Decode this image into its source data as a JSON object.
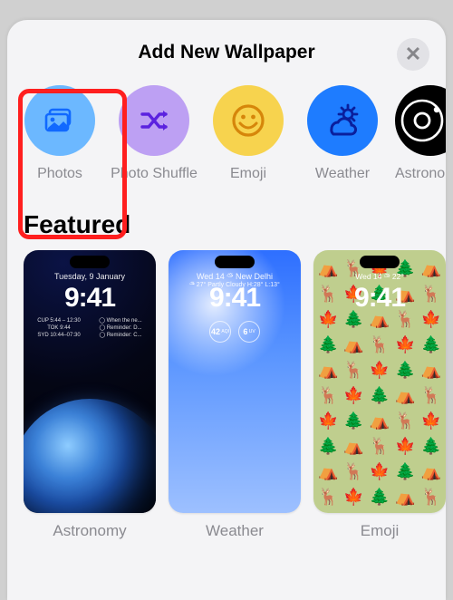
{
  "header": {
    "title": "Add New Wallpaper"
  },
  "categories": [
    {
      "key": "photos",
      "label": "Photos"
    },
    {
      "key": "shuffle",
      "label": "Photo Shuffle"
    },
    {
      "key": "emoji",
      "label": "Emoji"
    },
    {
      "key": "weather",
      "label": "Weather"
    },
    {
      "key": "astro",
      "label": "Astronomy"
    }
  ],
  "featured_heading": "Featured",
  "featured": [
    {
      "key": "astronomy",
      "label": "Astronomy",
      "date": "Tuesday, 9 January",
      "time": "9:41",
      "widgets_left": [
        "CUP  5:44 – 12:30",
        "TOK  9:44",
        "SYD 10:44–07:30"
      ],
      "widgets_right": [
        "◯ When the ne...",
        "◯ Reminder: D...",
        "◯ Reminder: C..."
      ]
    },
    {
      "key": "weather",
      "label": "Weather",
      "date": "Wed 14 ⛅︎ New Delhi",
      "time": "9:41",
      "sub": "⛅︎ 27°  Partly Cloudy  H:28° L:13°",
      "circles": [
        "42",
        "6"
      ]
    },
    {
      "key": "emoji",
      "label": "Emoji",
      "date": "Wed 14 ⛅︎ 22°",
      "time": "9:41",
      "pattern": [
        "⛺",
        "🦌",
        "🍁",
        "🌲",
        "⛺",
        "🦌",
        "🍁",
        "🌲",
        "⛺",
        "🦌",
        "🍁",
        "🌲",
        "⛺",
        "🦌",
        "🍁",
        "🌲",
        "⛺",
        "🦌",
        "🍁",
        "🌲",
        "⛺",
        "🦌",
        "🍁",
        "🌲",
        "⛺",
        "🦌",
        "🍁",
        "🌲",
        "⛺",
        "🦌",
        "🍁",
        "🌲",
        "⛺",
        "🦌",
        "🍁",
        "🌲",
        "⛺",
        "🦌",
        "🍁",
        "🌲",
        "⛺",
        "🦌",
        "🍁",
        "🌲",
        "⛺",
        "🦌",
        "🍁",
        "🌲",
        "⛺",
        "🦌"
      ]
    }
  ],
  "highlight_target": "photos"
}
